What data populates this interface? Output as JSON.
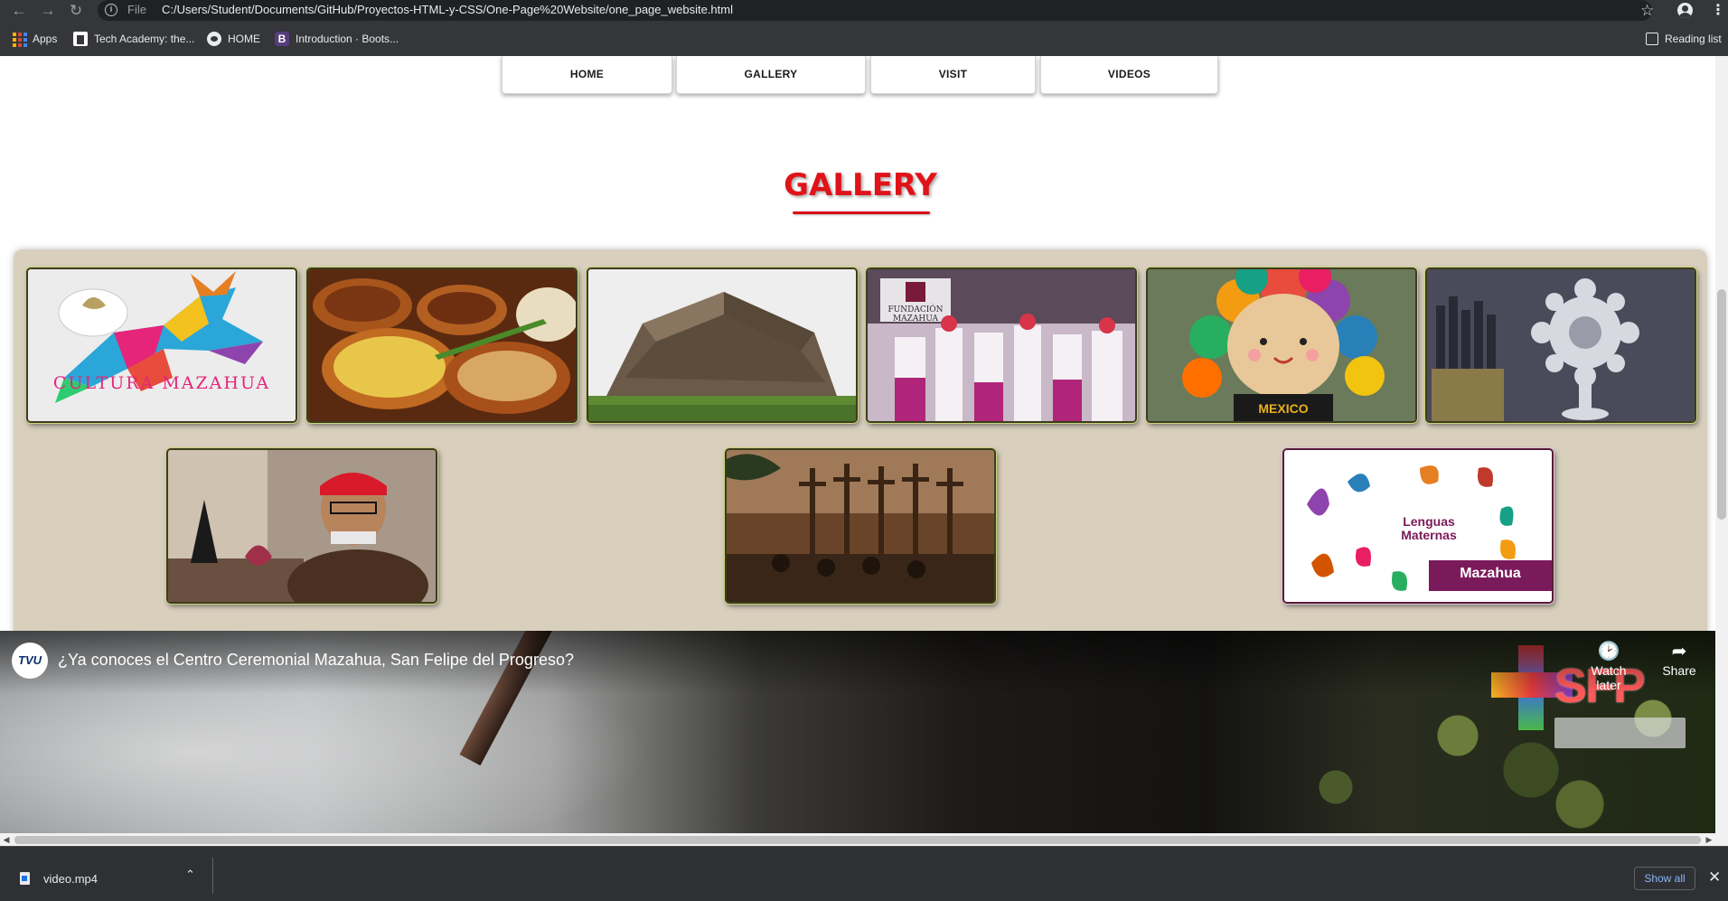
{
  "browser": {
    "scheme_label": "File",
    "url": "C:/Users/Student/Documents/GitHub/Proyectos-HTML-y-CSS/One-Page%20Website/one_page_website.html",
    "icons": [
      "back-icon",
      "forward-icon",
      "reload-icon",
      "info-icon",
      "star-icon",
      "profile-icon",
      "menu-icon"
    ]
  },
  "bookmarks": {
    "items": [
      {
        "label": "Apps",
        "icon": "apps-icon"
      },
      {
        "label": "Tech Academy: the...",
        "icon": "tech-academy-icon"
      },
      {
        "label": "HOME",
        "icon": "globe-icon"
      },
      {
        "label": "Introduction · Boots...",
        "icon": "bootstrap-icon",
        "icon_letter": "B"
      }
    ],
    "reading_list": "Reading list"
  },
  "site": {
    "nav": [
      "HOME",
      "GALLERY",
      "VISIT",
      "VIDEOS"
    ],
    "gallery_title": "GALLERY",
    "gallery_images": [
      {
        "subject": "cultura-mazahua-deer-logo",
        "caption_text": "CULTURA MAZAHUA",
        "accent": "#e6247a"
      },
      {
        "subject": "mazahua-food-dishes"
      },
      {
        "subject": "stone-pyramid-ruins"
      },
      {
        "subject": "fundacion-mazahua-dancers",
        "caption_text": "FUNDACIÓN MAZAHUA"
      },
      {
        "subject": "mazahua-rag-doll",
        "caption_text": "MEXICO"
      },
      {
        "subject": "silver-filigree-ornament"
      },
      {
        "subject": "artisan-with-jewelry"
      },
      {
        "subject": "historic-crucifixion-painting"
      },
      {
        "subject": "lenguas-maternas-mazahua",
        "caption_text": "Lenguas Maternas",
        "caption_tag": "Mazahua"
      }
    ]
  },
  "video": {
    "channel_avatar_text": "TVU",
    "title": "¿Ya conoces el Centro Ceremonial Mazahua, San Felipe del Progreso?",
    "watch_later": "Watch later",
    "share": "Share",
    "logo_text": "SFP"
  },
  "downloads": {
    "file_name": "video.mp4",
    "show_all": "Show all"
  }
}
